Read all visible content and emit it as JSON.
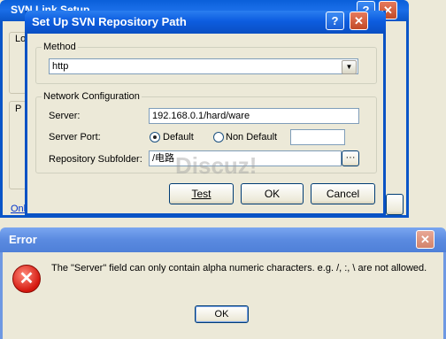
{
  "background_window": {
    "title": "SVN Link Setup",
    "left_labels": [
      "Lo",
      "P",
      "Onl"
    ]
  },
  "dialog": {
    "title": "Set Up SVN Repository Path",
    "help_glyph": "?",
    "close_glyph": "✕",
    "method": {
      "legend": "Method",
      "value": "http",
      "drop_glyph": "▼"
    },
    "network": {
      "legend": "Network Configuration",
      "server_label": "Server:",
      "server_value": "192.168.0.1/hard/ware",
      "port_label": "Server Port:",
      "port_default": "Default",
      "port_non_default": "Non Default",
      "port_selected": "Default",
      "port_value": "",
      "subfolder_label": "Repository Subfolder:",
      "subfolder_value": "/电路",
      "browse_label": "···"
    },
    "buttons": {
      "test": "Test",
      "ok": "OK",
      "cancel": "Cancel"
    }
  },
  "bg_window_buttons": {
    "help": "?",
    "close": "✕"
  },
  "watermark": "Discuz!",
  "error_dialog": {
    "title": "Error",
    "close_glyph": "✕",
    "icon_glyph": "✕",
    "message": "The \"Server\" field can only contain alpha numeric characters. e.g. /, :, \\ are not allowed.",
    "ok": "OK"
  },
  "colors": {
    "active_title": "#0a5fd9",
    "inactive_title": "#6e98e3",
    "dialog_face": "#ece9d8",
    "error_icon": "#d4170e"
  }
}
